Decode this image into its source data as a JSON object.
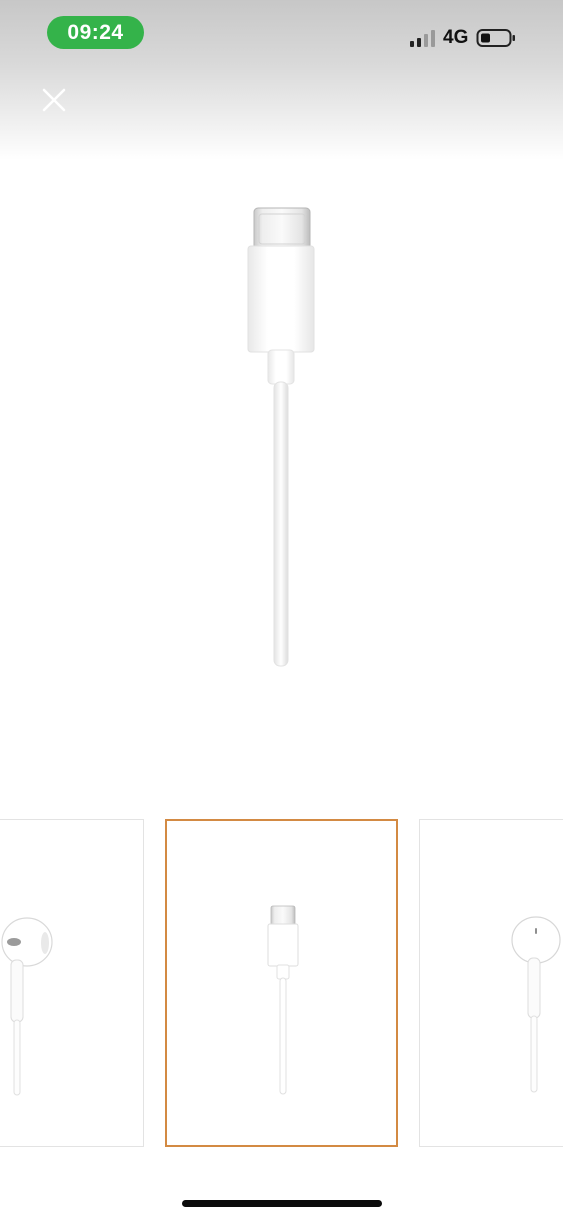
{
  "status_bar": {
    "time": "09:24",
    "network": "4G",
    "signal_icon": "signal-bars-icon",
    "battery_icon": "battery-icon",
    "time_pill_color": "#34b34a"
  },
  "toolbar": {
    "close_icon": "close-icon"
  },
  "gallery": {
    "main_image": "usb-c-earpods-connector",
    "thumbnails": [
      {
        "image": "earpods-left-earbud",
        "selected": false
      },
      {
        "image": "usb-c-earpods-connector",
        "selected": true
      },
      {
        "image": "earpods-right-earbud",
        "selected": false
      }
    ],
    "selected_border_color": "#d38a43"
  }
}
